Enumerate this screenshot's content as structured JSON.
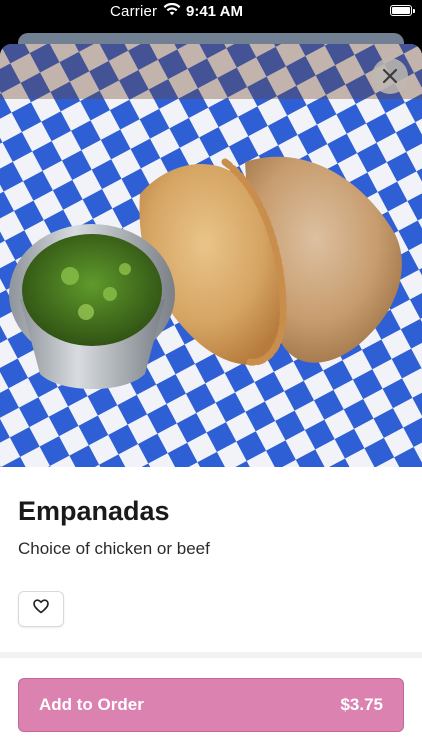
{
  "status_bar": {
    "carrier": "Carrier",
    "time": "9:41 AM",
    "icons": [
      "wifi-icon",
      "battery-icon"
    ]
  },
  "item": {
    "title": "Empanadas",
    "description": "Choice of chicken or beef",
    "image_alt_icon": "food-photo"
  },
  "actions": {
    "close_icon": "close-icon",
    "favorite_icon": "heart-icon",
    "add_label": "Add to Order",
    "price": "$3.75"
  },
  "colors": {
    "accent": "#db82b0",
    "accent_border": "#c26898",
    "title": "#1a1a1a"
  }
}
